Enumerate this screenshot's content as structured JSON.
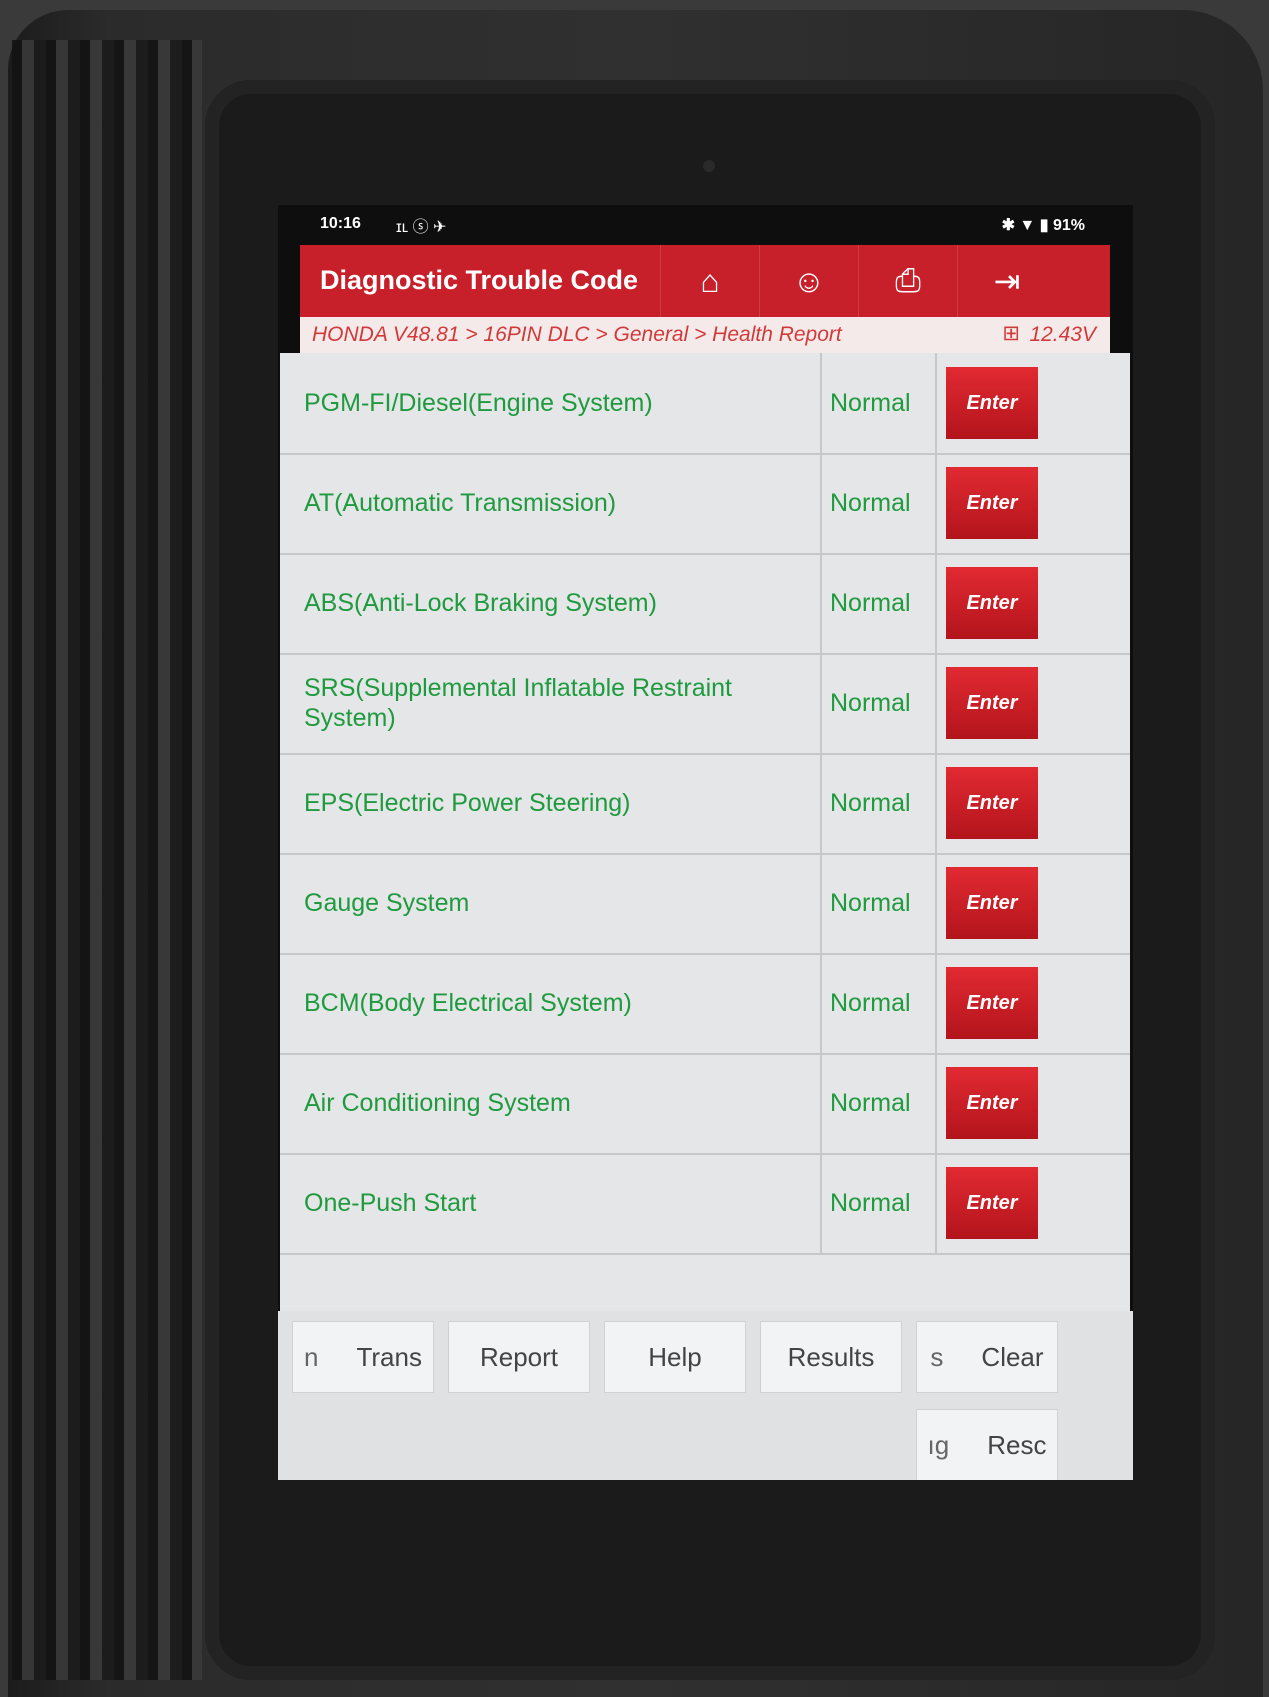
{
  "status_bar": {
    "time": "10:16",
    "left_icons": "ɪʟ ⓢ ✈",
    "battery": "91%",
    "right_icons": "✱ ▼ ▮"
  },
  "header": {
    "title": "Diagnostic Trouble Code",
    "tools": [
      {
        "icon": "home-icon",
        "glyph": "⌂"
      },
      {
        "icon": "user-icon",
        "glyph": "☺"
      },
      {
        "icon": "print-icon",
        "glyph": "⎙"
      },
      {
        "icon": "exit-icon",
        "glyph": "⇥"
      }
    ]
  },
  "breadcrumb": {
    "path": "HONDA V48.81 > 16PIN DLC > General > Health Report",
    "battery_icon": "⊞",
    "voltage": "12.43V"
  },
  "systems": [
    {
      "name": "PGM-FI/Diesel(Engine System)",
      "status": "Normal",
      "button": "Enter"
    },
    {
      "name": "AT(Automatic Transmission)",
      "status": "Normal",
      "button": "Enter"
    },
    {
      "name": "ABS(Anti-Lock Braking System)",
      "status": "Normal",
      "button": "Enter"
    },
    {
      "name": "SRS(Supplemental Inflatable Restraint System)",
      "status": "Normal",
      "button": "Enter"
    },
    {
      "name": "EPS(Electric Power Steering)",
      "status": "Normal",
      "button": "Enter"
    },
    {
      "name": "Gauge System",
      "status": "Normal",
      "button": "Enter"
    },
    {
      "name": "BCM(Body Electrical System)",
      "status": "Normal",
      "button": "Enter"
    },
    {
      "name": "Air Conditioning System",
      "status": "Normal",
      "button": "Enter"
    },
    {
      "name": "One-Push Start",
      "status": "Normal",
      "button": "Enter"
    }
  ],
  "bottom_buttons": {
    "row1": [
      {
        "pre": "n",
        "label": "Trans"
      },
      {
        "pre": "",
        "label": "Report"
      },
      {
        "pre": "",
        "label": "Help"
      },
      {
        "pre": "",
        "label": "Results"
      },
      {
        "pre": "s",
        "label": "Clear"
      }
    ],
    "row2": [
      {
        "pre": "ıg",
        "label": "Resc"
      }
    ]
  },
  "nav_bar": {
    "back": "◀",
    "home": "●",
    "recents": "■",
    "screenshot": "✂"
  },
  "colors": {
    "accent_red": "#c7202a",
    "status_green": "#1f9a3e",
    "list_bg": "#e4e6e7"
  }
}
